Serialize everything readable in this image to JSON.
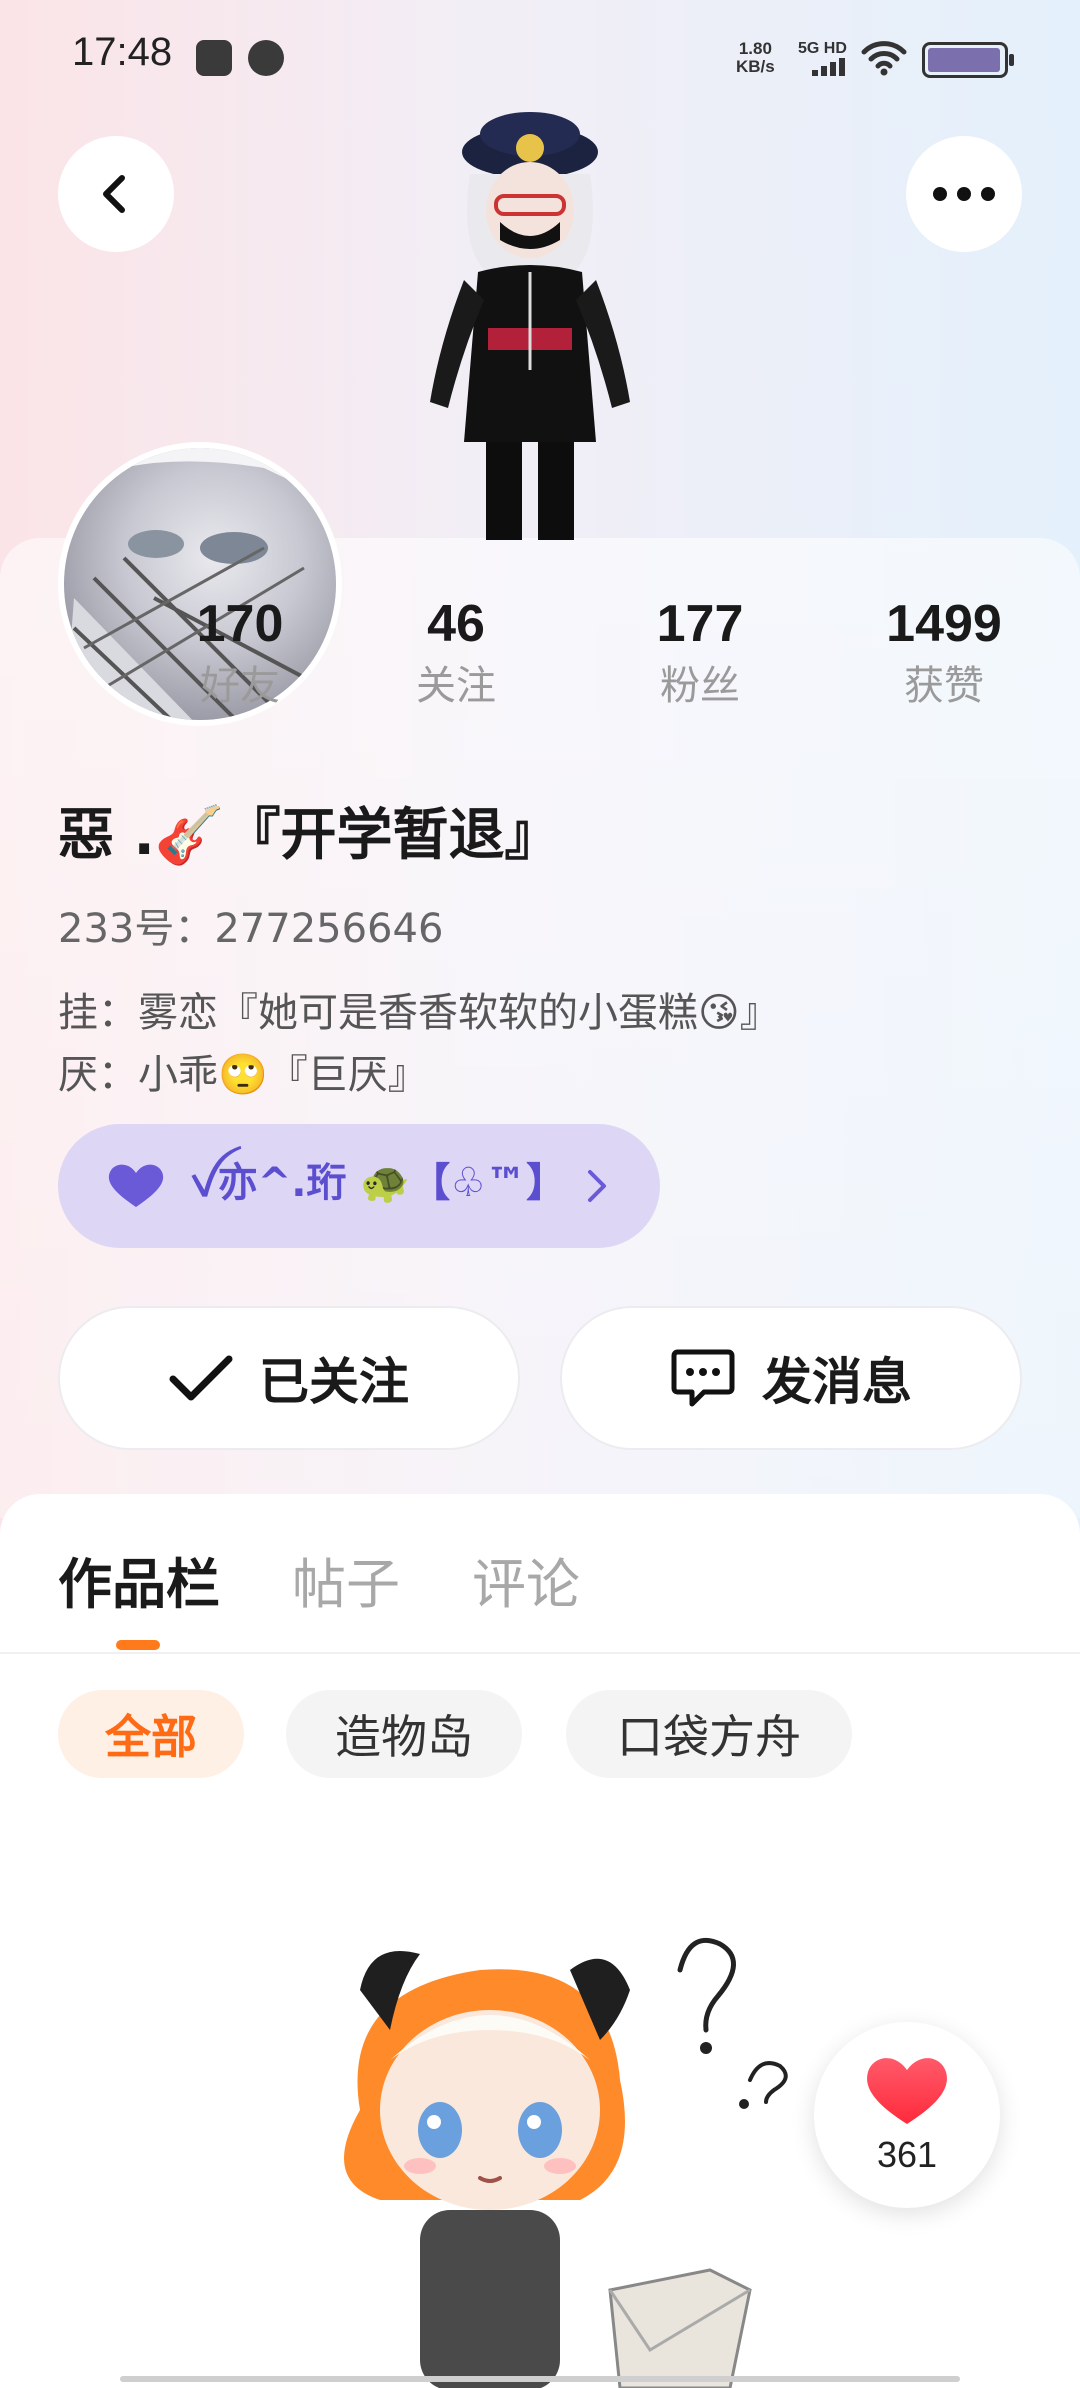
{
  "status_bar": {
    "time": "17:48",
    "net_speed_value": "1.80",
    "net_speed_unit": "KB/s",
    "network": "5G HD"
  },
  "header": {
    "back_icon": "chevron-left-icon",
    "more_icon": "more-horizontal-icon"
  },
  "profile": {
    "stats": [
      {
        "value": "170",
        "label": "好友"
      },
      {
        "value": "46",
        "label": "关注"
      },
      {
        "value": "177",
        "label": "粉丝"
      },
      {
        "value": "1499",
        "label": "获赞"
      }
    ],
    "name": "惡 .🎸『开学暂退』",
    "uid": "233号：277256646",
    "bio_lines": [
      "挂：雾恋『她可是香香软软的小蛋糕😘』",
      "厌：小乖🙄『巨厌』"
    ],
    "relation_pill": {
      "text": "ꪜ亦^.珩 🐢【♧™】",
      "icon": "heart-icon"
    },
    "actions": {
      "follow_label": "已关注",
      "message_label": "发消息"
    }
  },
  "tabs": [
    {
      "label": "作品栏",
      "active": true
    },
    {
      "label": "帖子",
      "active": false
    },
    {
      "label": "评论",
      "active": false
    }
  ],
  "filters": [
    {
      "label": "全部",
      "active": true
    },
    {
      "label": "造物岛",
      "active": false
    },
    {
      "label": "口袋方舟",
      "active": false
    }
  ],
  "like_badge": {
    "count": "361",
    "icon": "heart-icon"
  },
  "colors": {
    "accent": "#ff7a1a",
    "pill_bg": "#ddd6f5",
    "pill_text": "#5b4fd0",
    "heart": "#ff3b4e"
  }
}
